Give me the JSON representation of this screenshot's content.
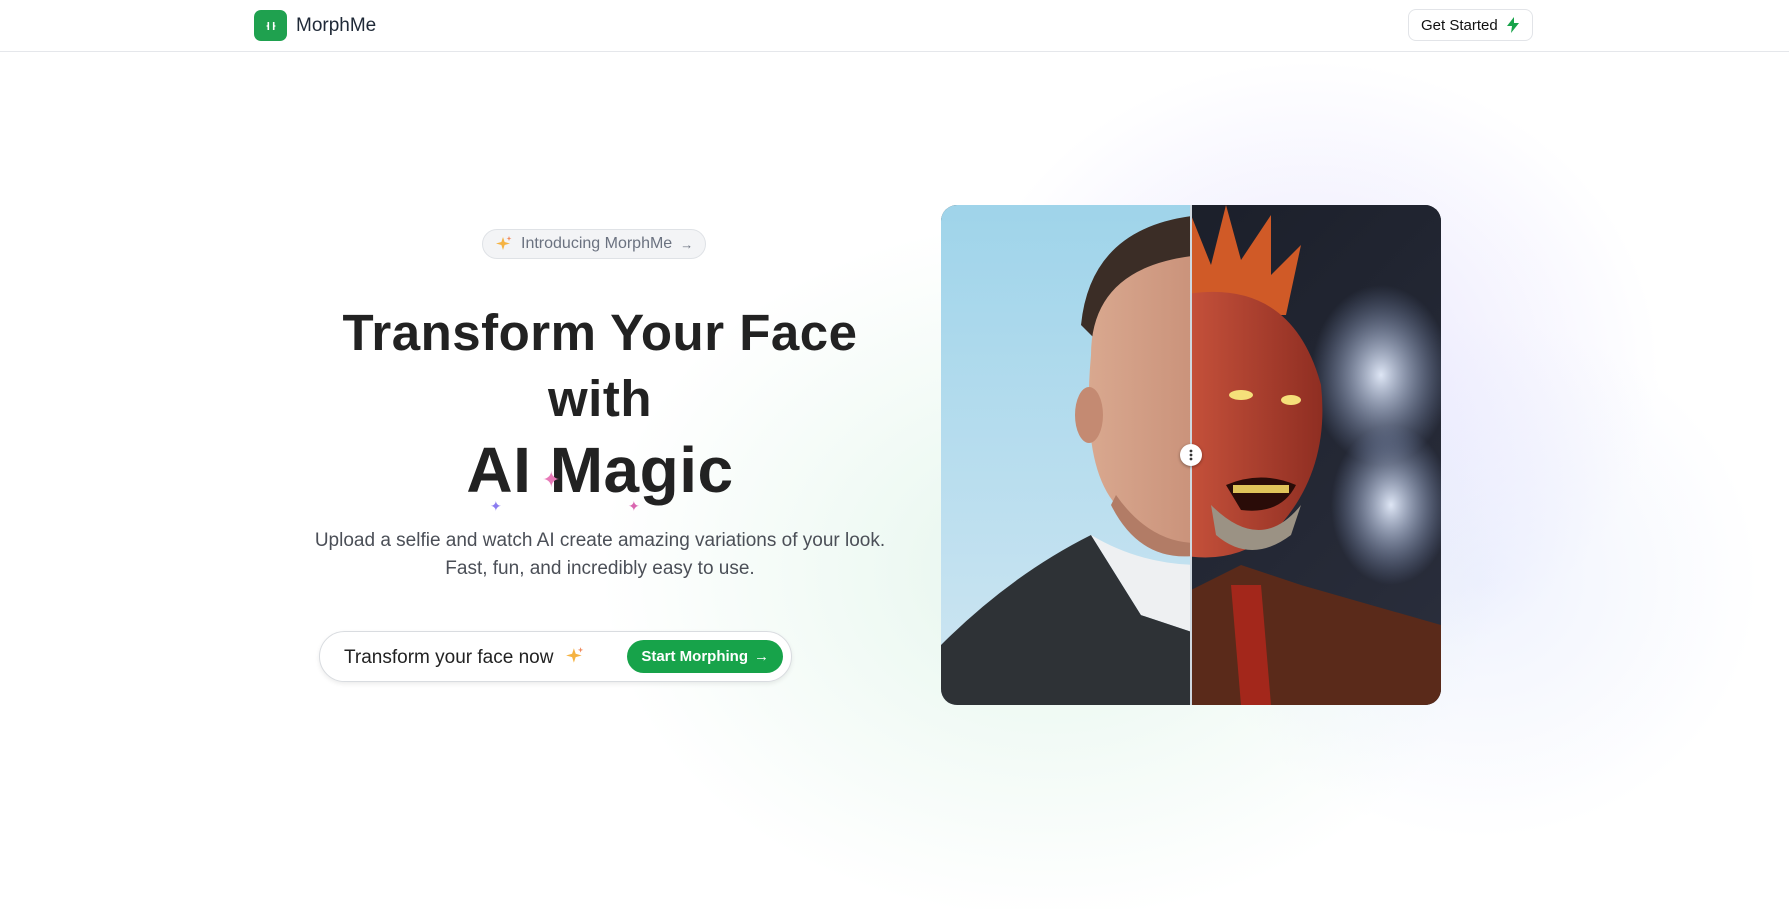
{
  "header": {
    "brand": "MorphMe",
    "get_started": "Get Started"
  },
  "hero": {
    "intro_pill": "Introducing MorphMe",
    "headline_line1": "Transform Your Face",
    "headline_line2": "with",
    "headline_line3": "AI Magic",
    "subtitle": "Upload a selfie and watch AI create amazing variations of your look. Fast, fun, and incredibly easy to use.",
    "cta_text": "Transform your face now",
    "cta_button": "Start Morphing"
  },
  "comparison": {
    "slider_position": 0.5
  },
  "colors": {
    "brand_green": "#17a34a",
    "text_dark": "#222222",
    "text_muted": "#6b7280"
  },
  "icons": {
    "logo": "morph-logo-icon",
    "get_started": "bolt-icon",
    "intro": "sparkles-icon",
    "arrow": "arrow-right-icon",
    "handle": "drag-handle-icon"
  }
}
